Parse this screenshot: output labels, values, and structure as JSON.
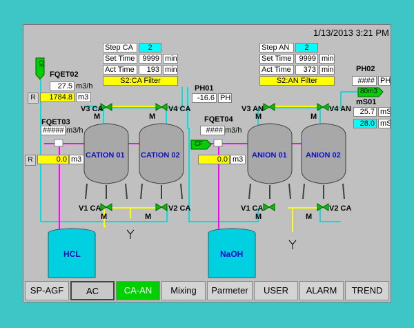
{
  "datetime": "1/13/2013 3:21 PM",
  "step_ca": {
    "step_label": "Step CA",
    "step_value": "2",
    "set_label": "Set Time",
    "set_value": "9999",
    "set_unit": "min",
    "act_label": "Act Time",
    "act_value": "193",
    "act_unit": "min",
    "status": "S2:CA Filter"
  },
  "step_an": {
    "step_label": "Step AN",
    "step_value": "2",
    "set_label": "Set Time",
    "set_value": "9999",
    "set_unit": "min",
    "act_label": "Act Time",
    "act_value": "373",
    "act_unit": "min",
    "status": "S2:AN Filter"
  },
  "fqet02": {
    "tag": "FQET02",
    "flow": "27.5",
    "flow_unit": "m3/h",
    "total": "1784.8",
    "total_unit": "m3",
    "reset": "R"
  },
  "fqet03": {
    "tag": "FQET03",
    "flow": "#####",
    "flow_unit": "m3/h",
    "total": "0.0",
    "total_unit": "m3",
    "reset": "R"
  },
  "fqet04": {
    "tag": "FQET04",
    "flow": "####",
    "flow_unit": "m3/h",
    "total": "0.0",
    "total_unit": "m3"
  },
  "ph01": {
    "tag": "PH01",
    "value": "-16.6",
    "unit": "PH"
  },
  "ph02": {
    "tag": "PH02",
    "value": "####",
    "unit": "PH",
    "flag": "80m3"
  },
  "ms01": {
    "tag": "mS01",
    "value": "25.7",
    "unit": "mS",
    "setpoint": "28.0",
    "setpoint_unit": "mS"
  },
  "tanks": {
    "cation1": "CATION 01",
    "cation2": "CATION 02",
    "anion1": "ANION 01",
    "anion2": "ANION 02",
    "hcl": "HCL",
    "naoh": "NaOH"
  },
  "valves": {
    "v3ca": "V3 CA",
    "v4ca": "V4 CA",
    "v1ca": "V1 CA",
    "v2ca": "V2 CA",
    "v3an": "V3 AN",
    "v4an": "V4 AN",
    "v1an": "V1 CA",
    "v2an": "V2 CA",
    "motor": "M"
  },
  "tags": {
    "cf": "CF"
  },
  "nav": [
    "SP-AGF",
    "AC",
    "CA-AN",
    "Mixing",
    "Parmeter",
    "USER",
    "ALARM",
    "TREND"
  ],
  "colors": {
    "background": "#3ec6c6",
    "pipe_water": "#00e0e0",
    "pipe_chem": "#ff00ff",
    "pipe_yellow": "#ffff00",
    "valve": "#00c000",
    "tank_fill": "#00d0e0",
    "active_tab": "#00d000"
  }
}
